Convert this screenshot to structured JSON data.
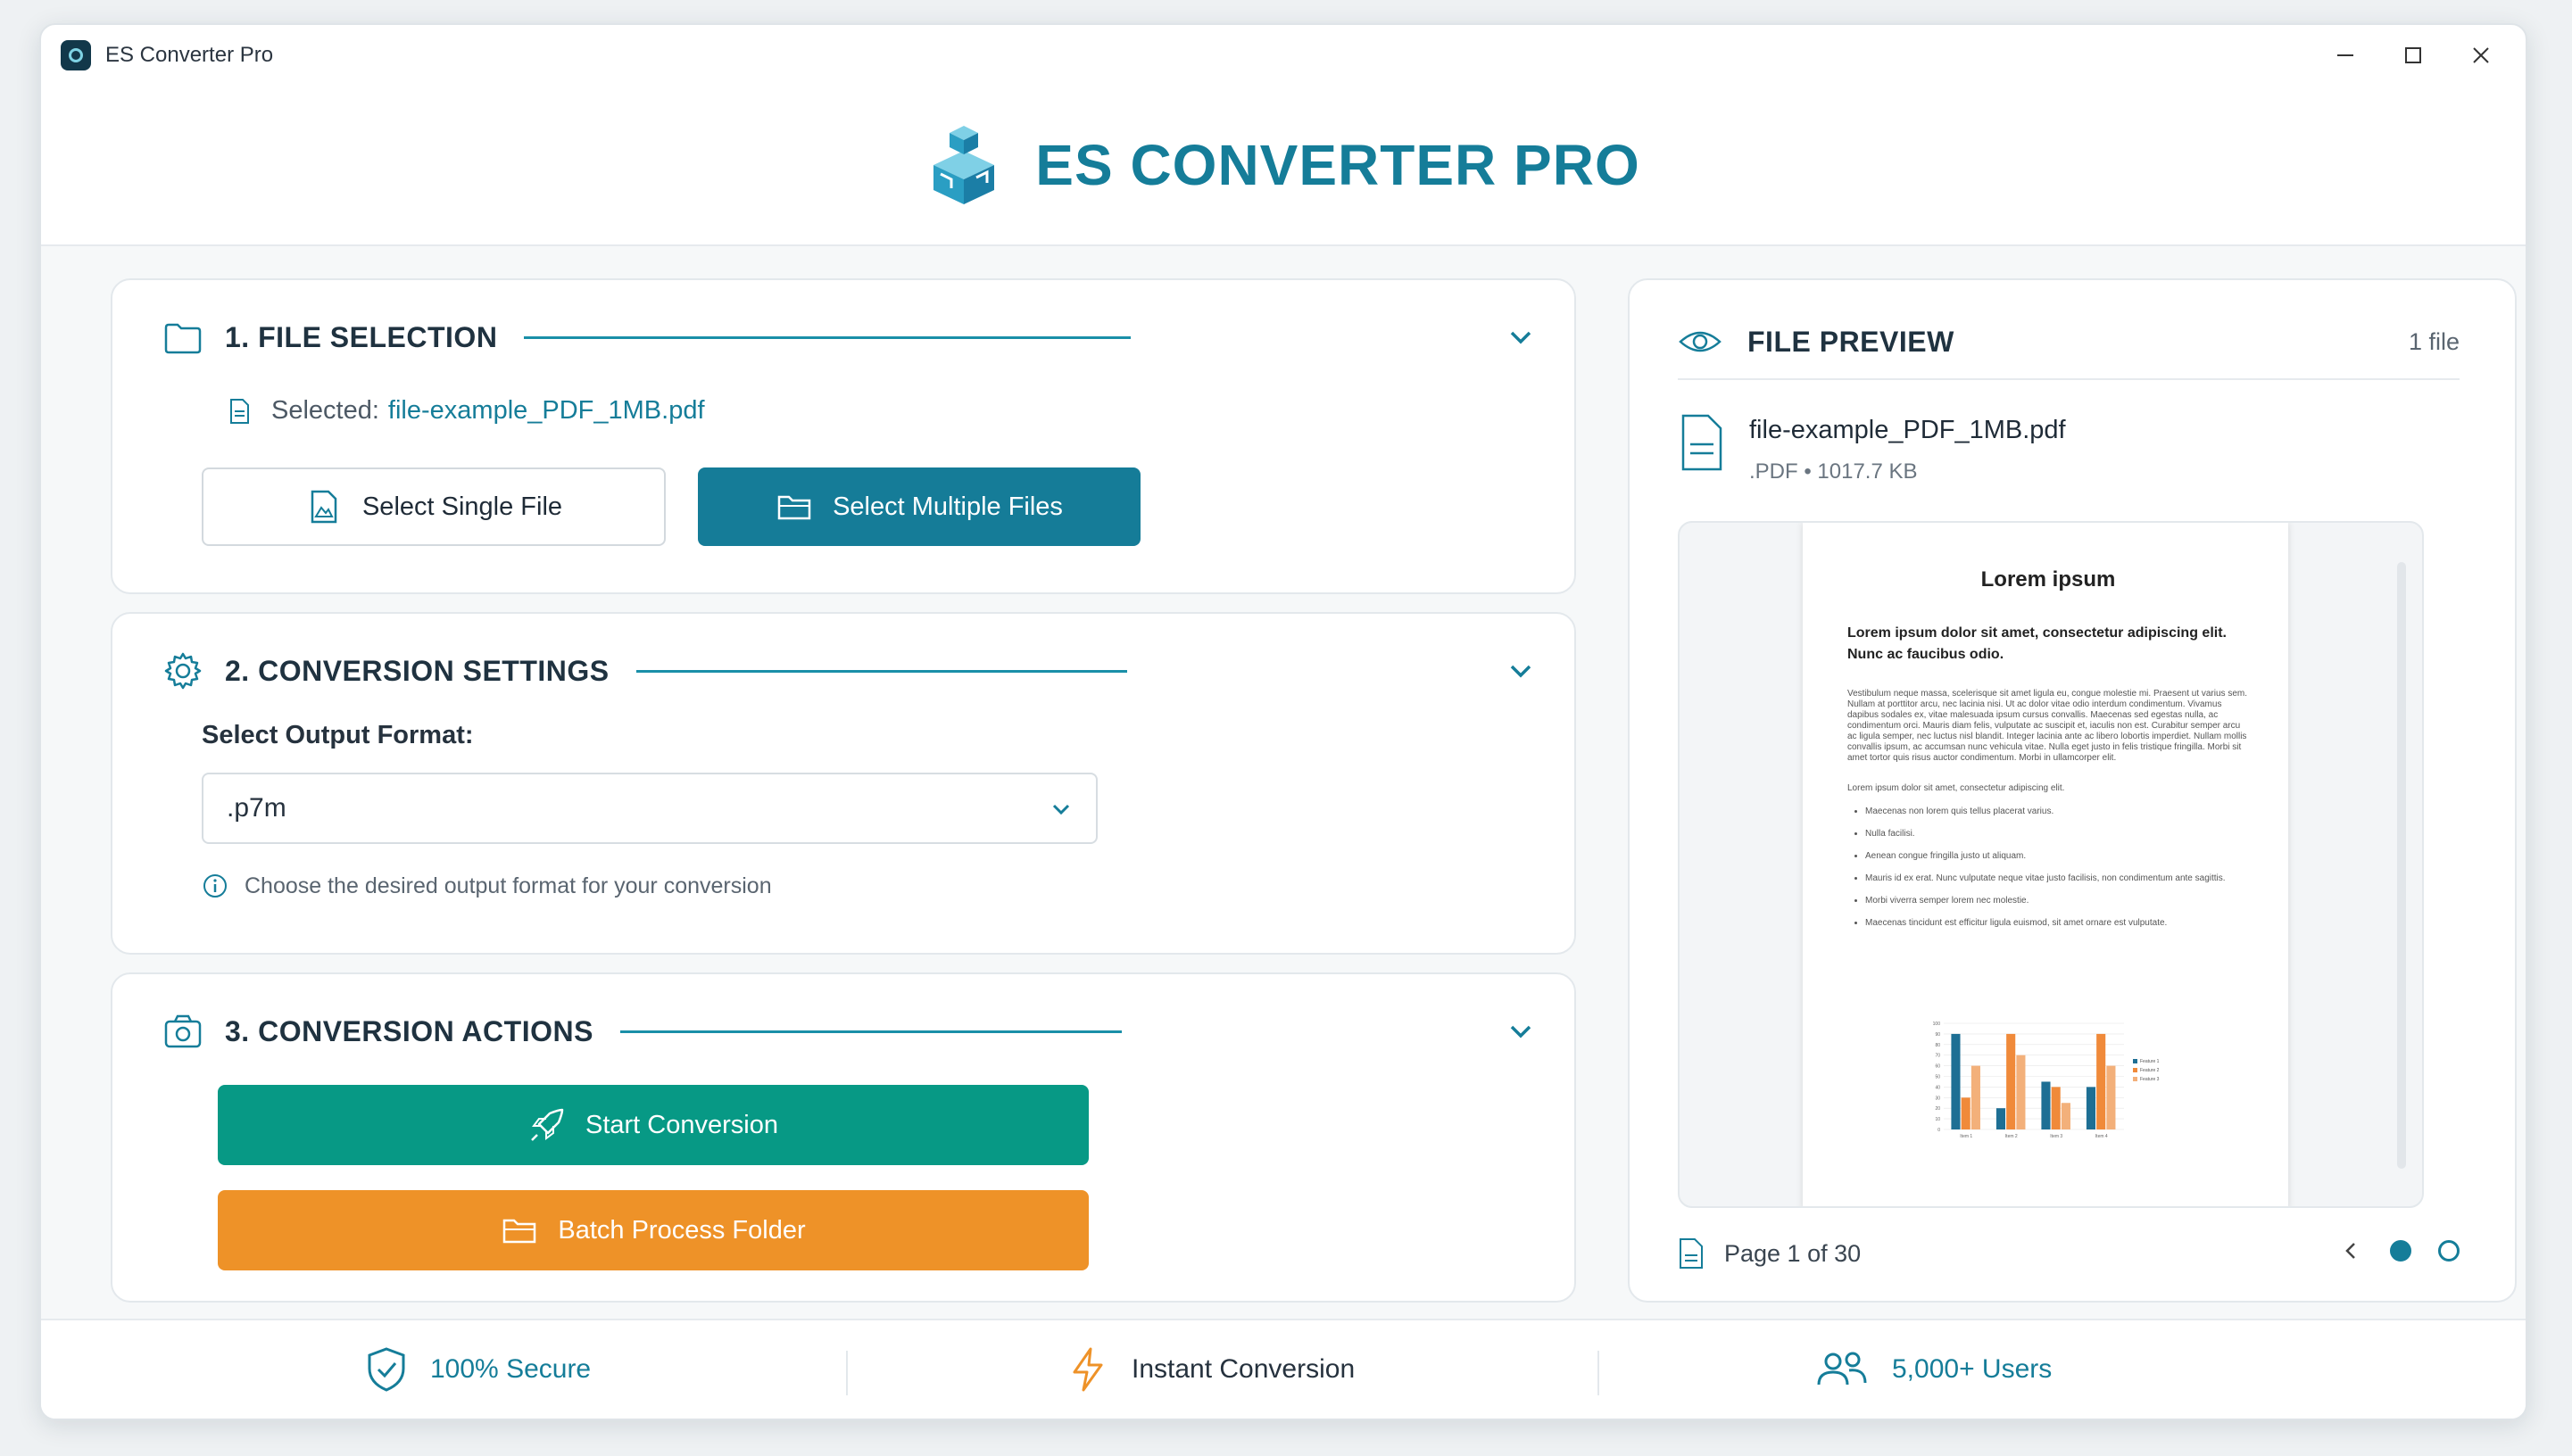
{
  "window": {
    "title": "ES Converter Pro"
  },
  "header": {
    "brand": "ES CONVERTER PRO"
  },
  "file_selection": {
    "title": "1. FILE SELECTION",
    "selected_label": "Selected:",
    "selected_file": "file-example_PDF_1MB.pdf",
    "single_label": "Select Single File",
    "multiple_label": "Select Multiple Files"
  },
  "settings": {
    "title": "2. CONVERSION SETTINGS",
    "format_label": "Select Output Format:",
    "format_value": ".p7m",
    "hint": "Choose the desired output format for your conversion"
  },
  "actions": {
    "title": "3. CONVERSION ACTIONS",
    "start_label": "Start Conversion",
    "batch_label": "Batch Process Folder"
  },
  "preview": {
    "title": "FILE PREVIEW",
    "count": "1 file",
    "file_name": "file-example_PDF_1MB.pdf",
    "file_meta": ".PDF • 1017.7 KB",
    "page_label": "Page 1 of 30",
    "doc": {
      "title": "Lorem ipsum",
      "lead": "Lorem ipsum dolor sit amet, consectetur adipiscing elit. Nunc ac faucibus odio.",
      "para": "Vestibulum neque massa, scelerisque sit amet ligula eu, congue molestie mi. Praesent ut varius sem. Nullam at porttitor arcu, nec lacinia nisi. Ut ac dolor vitae odio interdum condimentum. Vivamus dapibus sodales ex, vitae malesuada ipsum cursus convallis. Maecenas sed egestas nulla, ac condimentum orci. Mauris diam felis, vulputate ac suscipit et, iaculis non est. Curabitur semper arcu ac ligula semper, nec luctus nisl blandit. Integer lacinia ante ac libero lobortis imperdiet. Nullam mollis convallis ipsum, ac accumsan nunc vehicula vitae. Nulla eget justo in felis tristique fringilla. Morbi sit amet tortor quis risus auctor condimentum. Morbi in ullamcorper elit.",
      "para2": "Lorem ipsum dolor sit amet, consectetur adipiscing elit.",
      "bullets": [
        "Maecenas non lorem quis tellus placerat varius.",
        "Nulla facilisi.",
        "Aenean congue fringilla justo ut aliquam.",
        "Mauris id ex erat. Nunc vulputate neque vitae justo facilisis, non condimentum ante sagittis.",
        "Morbi viverra semper lorem nec molestie.",
        "Maecenas tincidunt est efficitur ligula euismod, sit amet ornare est vulputate."
      ]
    }
  },
  "footer": {
    "secure": "100% Secure",
    "instant": "Instant Conversion",
    "users": "5,000+ Users"
  },
  "chart_data": {
    "type": "bar",
    "categories": [
      "Item 1",
      "Item 2",
      "Item 3",
      "Item 4"
    ],
    "series": [
      {
        "name": "Feature 1",
        "values": [
          90,
          20,
          45,
          40
        ]
      },
      {
        "name": "Feature 2",
        "values": [
          30,
          90,
          40,
          90
        ]
      },
      {
        "name": "Feature 3",
        "values": [
          60,
          70,
          25,
          60
        ]
      }
    ],
    "ylim": [
      0,
      100
    ],
    "yticks": [
      0,
      10,
      20,
      30,
      40,
      50,
      60,
      70,
      80,
      90,
      100
    ],
    "colors": [
      "#1e6f94",
      "#f08a3a",
      "#f3b07a"
    ],
    "legend": "right"
  },
  "colors": {
    "accent": "#157d99",
    "green": "#079985",
    "orange": "#ee9228"
  }
}
